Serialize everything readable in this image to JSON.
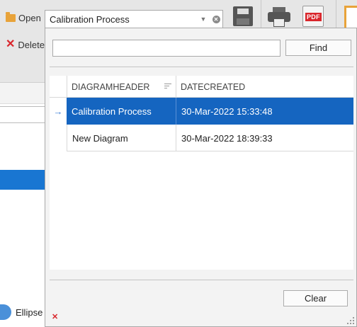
{
  "background": {
    "toolbar": {
      "open_label": "Open",
      "delete_label": "Delete",
      "save_icon": "save-icon",
      "print_icon": "print-icon",
      "pdf_label": "PDF",
      "clipboard_icon": "clipboard-icon"
    },
    "shape_item_label": "Ellipse"
  },
  "combo": {
    "value": "Calibration Process"
  },
  "popup": {
    "search": {
      "value": "",
      "placeholder": ""
    },
    "find_label": "Find",
    "clear_label": "Clear",
    "grid": {
      "columns": [
        "DIAGRAMHEADER",
        "DATECREATED"
      ],
      "rows": [
        {
          "header": "Calibration Process",
          "date": "30-Mar-2022 15:33:48",
          "selected": true
        },
        {
          "header": "New Diagram",
          "date": "30-Mar-2022 18:39:33",
          "selected": false
        }
      ]
    }
  },
  "colors": {
    "selection": "#1565c0",
    "accent_red": "#d9262c",
    "folder_orange": "#e8a33a"
  }
}
